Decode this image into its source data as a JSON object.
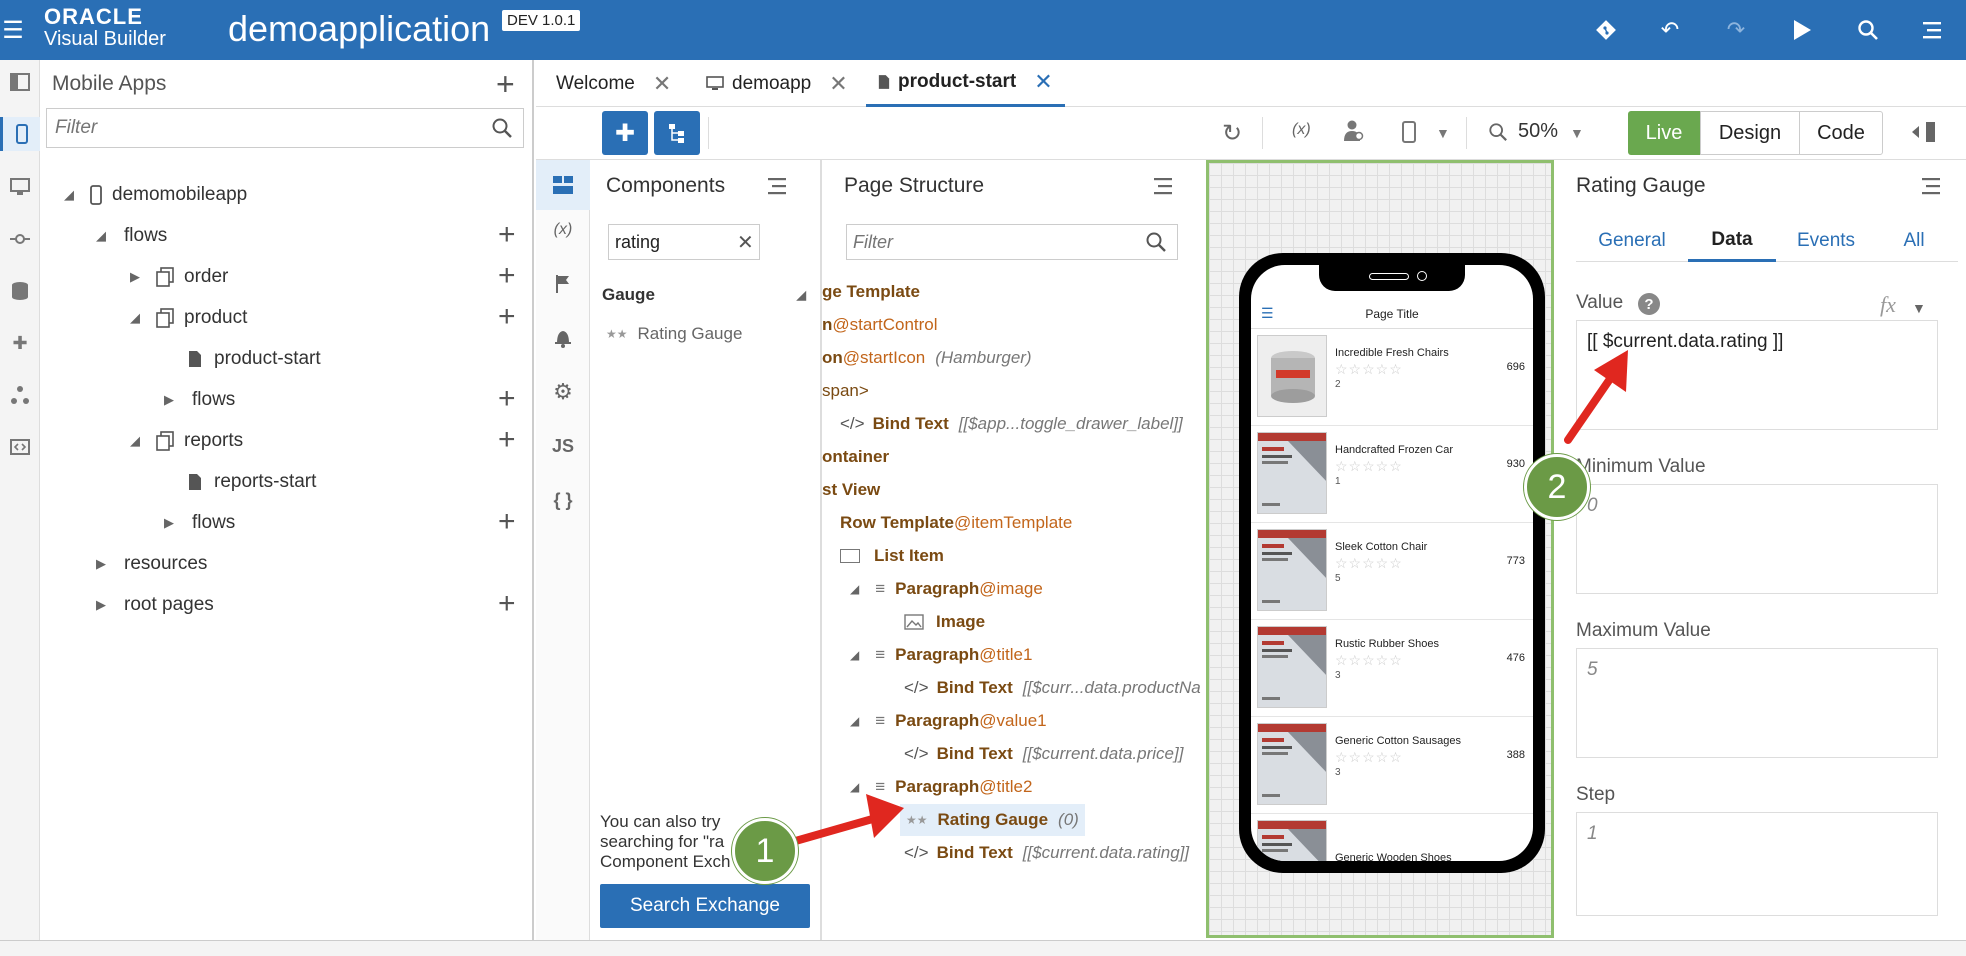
{
  "header": {
    "oracle_label": "ORACLE",
    "vb_label": "Visual Builder",
    "app_title": "demoapplication",
    "version_badge": "DEV 1.0.1"
  },
  "nav": {
    "title": "Mobile Apps",
    "filter_placeholder": "Filter",
    "tree": {
      "app": "demomobileapp",
      "flows": "flows",
      "order": "order",
      "product": "product",
      "product_start": "product-start",
      "product_flows": "flows",
      "reports": "reports",
      "reports_start": "reports-start",
      "reports_flows": "flows",
      "resources": "resources",
      "root_pages": "root pages"
    }
  },
  "tabs": [
    {
      "label": "Welcome"
    },
    {
      "label": "demoapp"
    },
    {
      "label": "product-start"
    }
  ],
  "toolbar": {
    "zoom": "50%",
    "live": "Live",
    "design": "Design",
    "code": "Code"
  },
  "vstrip": {
    "fx": "(x)",
    "js": "JS",
    "braces": "{ }"
  },
  "components": {
    "title": "Components",
    "search_value": "rating",
    "group": "Gauge",
    "item": "Rating Gauge",
    "hint_line1": "You can also try",
    "hint_line2": "searching for \"ra",
    "hint_line3": "Component Exch",
    "search_exchange": "Search Exchange"
  },
  "structure": {
    "title": "Page Structure",
    "filter_placeholder": "Filter",
    "rows": {
      "r1": "ge Template",
      "r2a": "n",
      "r2b": "@startControl",
      "r3a": "on",
      "r3b": "@startIcon",
      "r3c": "(Hamburger)",
      "r4": "span>",
      "r5a": "Bind Text",
      "r5b": "[[$app...toggle_drawer_label]]",
      "r6": "ontainer",
      "r7": "st View",
      "r8a": "Row Template",
      "r8b": "@itemTemplate",
      "r9": "List Item",
      "r10a": "Paragraph",
      "r10b": "@image",
      "r11": "Image",
      "r12a": "Paragraph",
      "r12b": "@title1",
      "r13a": "Bind Text",
      "r13b": "[[$curr...data.productNa",
      "r14a": "Paragraph",
      "r14b": "@value1",
      "r15a": "Bind Text",
      "r15b": "[[$current.data.price]]",
      "r16a": "Paragraph",
      "r16b": "@title2",
      "r17a": "Rating Gauge",
      "r17b": "(0)",
      "r18a": "Bind Text",
      "r18b": "[[$current.data.rating]]"
    }
  },
  "phone": {
    "page_title": "Page Title",
    "items": [
      {
        "name": "Incredible Fresh Chairs",
        "price": "696",
        "rating_label": "2",
        "thumb": "db"
      },
      {
        "name": "Handcrafted Frozen Car",
        "price": "930",
        "rating_label": "1",
        "thumb": "book"
      },
      {
        "name": "Sleek Cotton Chair",
        "price": "773",
        "rating_label": "5",
        "thumb": "book"
      },
      {
        "name": "Rustic Rubber Shoes",
        "price": "476",
        "rating_label": "3",
        "thumb": "book"
      },
      {
        "name": "Generic Cotton Sausages",
        "price": "388",
        "rating_label": "3",
        "thumb": "book"
      },
      {
        "name": "Generic Wooden Shoes",
        "price": "",
        "rating_label": "",
        "thumb": "book"
      }
    ]
  },
  "props": {
    "title": "Rating Gauge",
    "tabs": [
      "General",
      "Data",
      "Events",
      "All"
    ],
    "value_label": "Value",
    "value": "[[ $current.data.rating ]]",
    "fx": "fx",
    "min_label": "Minimum Value",
    "min_value": "0",
    "max_label": "Maximum Value",
    "max_value": "5",
    "step_label": "Step",
    "step_value": "1"
  },
  "callouts": {
    "one": "1",
    "two": "2"
  },
  "colors": {
    "header": "#2a6fb5",
    "accent": "#c2651a",
    "live": "#6aa84f",
    "callout": "#6b9a46",
    "arrow": "#e0271f"
  }
}
